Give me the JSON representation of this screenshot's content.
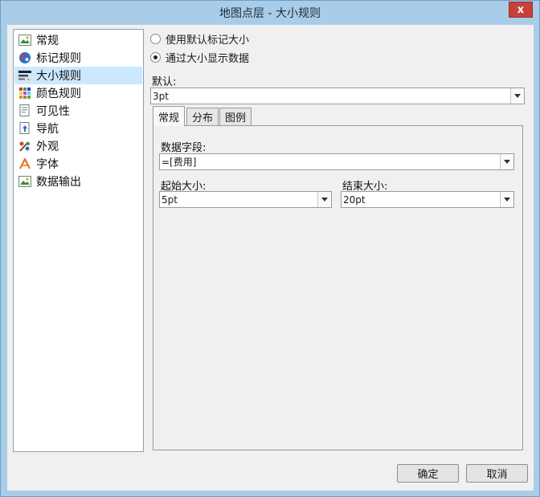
{
  "window": {
    "title": "地图点层 - 大小规则",
    "close_glyph": "x"
  },
  "sidebar": {
    "items": [
      {
        "label": "常规",
        "icon": "image-icon"
      },
      {
        "label": "标记规则",
        "icon": "marker-rule-icon"
      },
      {
        "label": "大小规则",
        "icon": "size-rule-icon",
        "selected": true
      },
      {
        "label": "颜色规则",
        "icon": "color-grid-icon"
      },
      {
        "label": "可见性",
        "icon": "visibility-icon"
      },
      {
        "label": "导航",
        "icon": "navigation-icon"
      },
      {
        "label": "外观",
        "icon": "appearance-icon"
      },
      {
        "label": "字体",
        "icon": "font-icon"
      },
      {
        "label": "数据输出",
        "icon": "data-output-icon"
      }
    ]
  },
  "options": {
    "radio_default": "使用默认标记大小",
    "radio_data": "通过大小显示数据",
    "selected": "radio_data"
  },
  "default_size": {
    "label": "默认:",
    "value": "3pt"
  },
  "tabs": [
    {
      "label": "常规",
      "active": true
    },
    {
      "label": "分布",
      "active": false
    },
    {
      "label": "图例",
      "active": false
    }
  ],
  "general_tab": {
    "data_field_label": "数据字段:",
    "data_field_value": "=[费用]",
    "start_size_label": "起始大小:",
    "start_size_value": "5pt",
    "end_size_label": "结束大小:",
    "end_size_value": "20pt"
  },
  "buttons": {
    "ok": "确定",
    "cancel": "取消"
  },
  "colors": {
    "title_bar": "#a9cde8",
    "selection": "#cce8ff",
    "close": "#c7413a"
  }
}
